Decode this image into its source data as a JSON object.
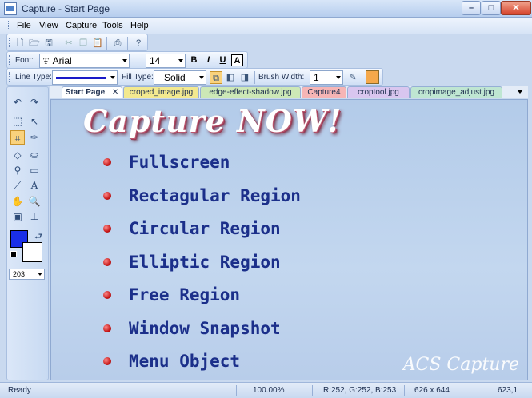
{
  "window": {
    "title": "Capture - Start Page"
  },
  "menu": [
    "File",
    "View",
    "Capture",
    "Tools",
    "Help"
  ],
  "font_toolbar": {
    "label": "Font:",
    "font": "Arial",
    "size": "14",
    "bold": "B",
    "italic": "I",
    "underline": "U",
    "boxed": "A"
  },
  "style_toolbar": {
    "line_type_label": "Line Type:",
    "fill_type_label": "Fill Type:",
    "fill_type": "Solid",
    "brush_width_label": "Brush Width:",
    "brush_width": "1",
    "fill_color": "#f5a84a",
    "line_color": "#1a1ac8"
  },
  "tools": {
    "fg_color": "#1a2fe8",
    "bg_color": "#ffffff",
    "opacity_value": "203"
  },
  "tabs": [
    {
      "label": "Start Page",
      "color": "#ffffff"
    },
    {
      "label": "croped_image.jpg",
      "color": "#f3e98f"
    },
    {
      "label": "edge-effect-shadow.jpg",
      "color": "#cde8b6"
    },
    {
      "label": "Capture4",
      "color": "#f6b5b5"
    },
    {
      "label": "croptool.jpg",
      "color": "#d9c6ef"
    },
    {
      "label": "cropimage_adjust.jpg",
      "color": "#bfe6d2"
    }
  ],
  "start_page": {
    "headline": "Capture NOW!",
    "options": [
      "Fullscreen",
      "Rectagular Region",
      "Circular Region",
      "Elliptic Region",
      "Free Region",
      "Window Snapshot",
      "Menu Object"
    ],
    "watermark": "ACS Capture"
  },
  "status": {
    "state": "Ready",
    "zoom": "100.00%",
    "rgb": "R:252, G:252, B:253",
    "dimensions": "626 x 644",
    "position": "623,1"
  }
}
